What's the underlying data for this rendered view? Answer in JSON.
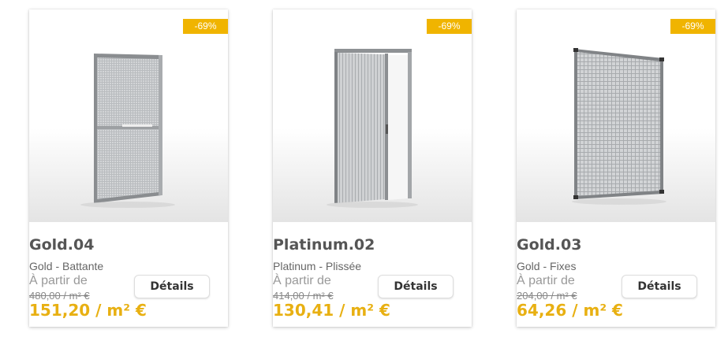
{
  "products": [
    {
      "discount_badge": "-69%",
      "name": "Gold.04",
      "subtitle": "Gold - Battante",
      "from_label": "À partir de",
      "old_price": "480,00 / m² €",
      "price": "151,20 / m² €",
      "details_label": "Détails",
      "image_icon": "hinged-door-screen-image"
    },
    {
      "discount_badge": "-69%",
      "name": "Platinum.02",
      "subtitle": "Platinum - Plissée",
      "from_label": "À partir de",
      "old_price": "414,00 / m² €",
      "price": "130,41 / m² €",
      "details_label": "Détails",
      "image_icon": "pleated-door-screen-image"
    },
    {
      "discount_badge": "-69%",
      "name": "Gold.03",
      "subtitle": "Gold - Fixes",
      "from_label": "À partir de",
      "old_price": "204,00 / m² €",
      "price": "64,26 / m² €",
      "details_label": "Détails",
      "image_icon": "fixed-screen-image"
    }
  ],
  "colors": {
    "badge": "#f0b400",
    "price": "#e8b012"
  }
}
